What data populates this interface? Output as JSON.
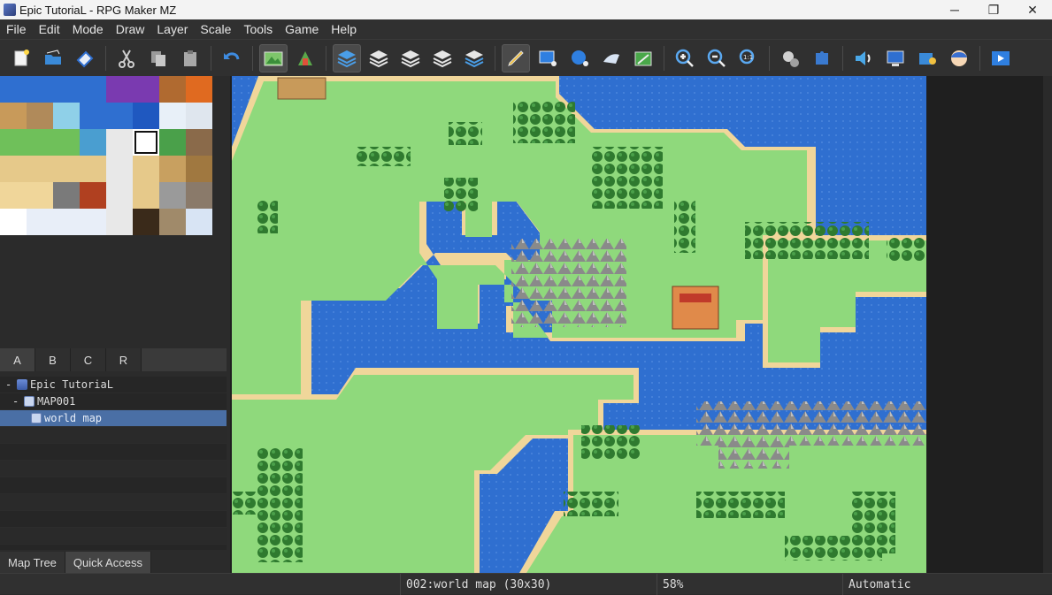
{
  "window": {
    "title": "Epic TutoriaL - RPG Maker MZ",
    "minimize": "─",
    "restore": "❐",
    "close": "✕"
  },
  "menu": [
    "File",
    "Edit",
    "Mode",
    "Draw",
    "Layer",
    "Scale",
    "Tools",
    "Game",
    "Help"
  ],
  "toolbar": {
    "groups": [
      [
        "new-project",
        "open-project",
        "save-project"
      ],
      [
        "cut",
        "copy",
        "paste"
      ],
      [
        "undo"
      ],
      [
        "map-mode",
        "event-mode"
      ],
      [
        "layer-auto",
        "layer-1",
        "layer-2",
        "layer-3",
        "layer-4"
      ],
      [
        "pencil",
        "rectangle",
        "ellipse",
        "fill",
        "shadow-pen"
      ],
      [
        "zoom-in",
        "zoom-out",
        "zoom-actual"
      ],
      [
        "database",
        "plugin-manager"
      ],
      [
        "sound-test",
        "event-searcher",
        "resource-manager",
        "character-generator"
      ],
      [
        "playtest"
      ]
    ]
  },
  "tileset_tabs": [
    "A",
    "B",
    "C",
    "R"
  ],
  "tree": {
    "project": "Epic TutoriaL",
    "map_group": "MAP001",
    "map": "world map"
  },
  "bottom_tabs": [
    "Map Tree",
    "Quick Access"
  ],
  "status": {
    "map_info": "002:world map (30x30)",
    "zoom": "58%",
    "mode": "Automatic"
  },
  "colors": {
    "water": "#2f6fd0",
    "grass": "#88d977",
    "sand": "#f0d69a",
    "forest": "#2f7a2f",
    "rock": "#8c8c8c"
  }
}
